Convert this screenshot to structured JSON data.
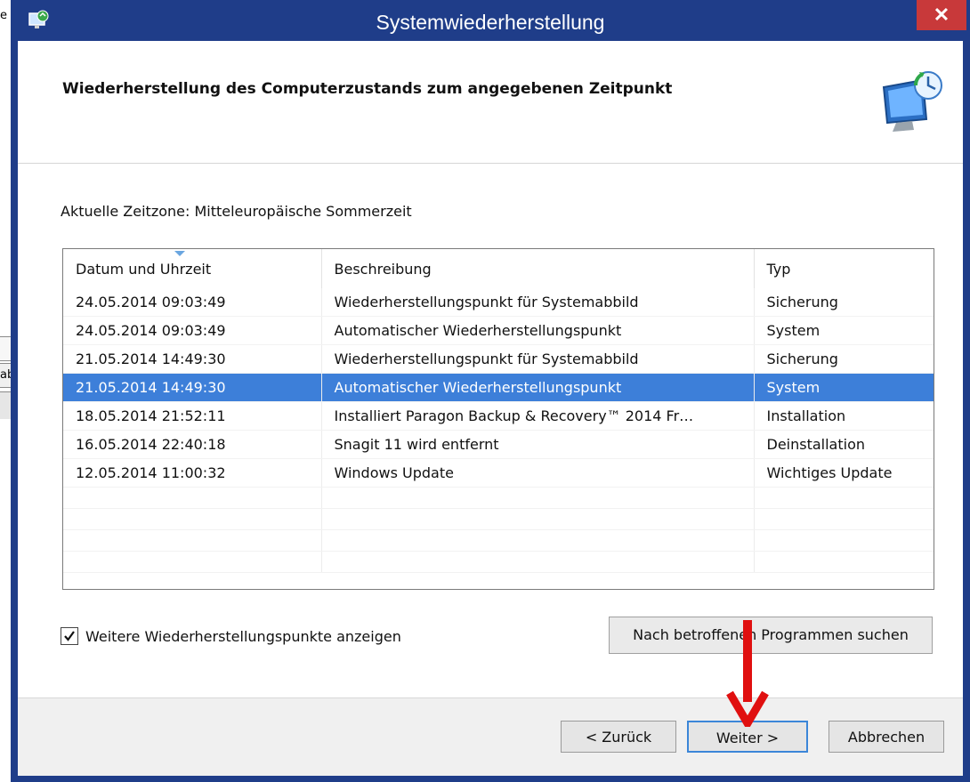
{
  "background_window": {
    "text_top": "e",
    "text_button": "ab"
  },
  "window": {
    "title": "Systemwiederherstellung",
    "close_label": "✕",
    "heading": "Wiederherstellung des Computerzustands zum angegebenen Zeitpunkt"
  },
  "timezone_label": "Aktuelle Zeitzone: Mitteleuropäische Sommerzeit",
  "table": {
    "columns": [
      "Datum und Uhrzeit",
      "Beschreibung",
      "Typ"
    ],
    "rows": [
      {
        "date": "24.05.2014 09:03:49",
        "desc": "Wiederherstellungspunkt für Systemabbild",
        "type": "Sicherung"
      },
      {
        "date": "24.05.2014 09:03:49",
        "desc": "Automatischer Wiederherstellungspunkt",
        "type": "System"
      },
      {
        "date": "21.05.2014 14:49:30",
        "desc": "Wiederherstellungspunkt für Systemabbild",
        "type": "Sicherung"
      },
      {
        "date": "21.05.2014 14:49:30",
        "desc": "Automatischer Wiederherstellungspunkt",
        "type": "System"
      },
      {
        "date": "18.05.2014 21:52:11",
        "desc": "Installiert Paragon Backup & Recovery™ 2014 Fr…",
        "type": "Installation"
      },
      {
        "date": "16.05.2014 22:40:18",
        "desc": "Snagit 11 wird entfernt",
        "type": "Deinstallation"
      },
      {
        "date": "12.05.2014 11:00:32",
        "desc": "Windows Update",
        "type": "Wichtiges Update"
      }
    ],
    "selected_row_index": 3
  },
  "more_points_label": "Weitere Wiederherstellungspunkte anzeigen",
  "more_points_checked": true,
  "search_button_label": "Nach betroffenen Programmen suchen",
  "footer": {
    "back_label": "< Zurück",
    "next_label": "Weiter >",
    "cancel_label": "Abbrechen"
  },
  "colors": {
    "titlebar": "#1f3d89",
    "close_button": "#c8393a",
    "selection": "#3d7fd9",
    "annotation_arrow": "#e01010"
  },
  "icons": [
    "system-restore-app-icon",
    "system-restore-header-icon",
    "checkmark-icon",
    "sort-arrow-icon",
    "red-arrow-annotation-icon"
  ]
}
